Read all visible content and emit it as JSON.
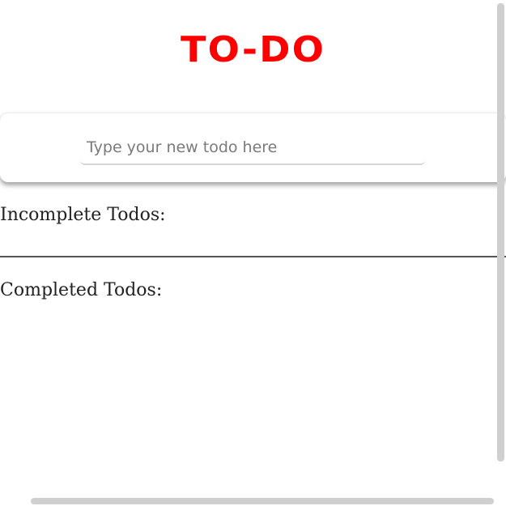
{
  "header": {
    "title": "TO-DO",
    "title_color": "#ff0000"
  },
  "input": {
    "placeholder": "Type your new todo here",
    "value": ""
  },
  "sections": {
    "incomplete": {
      "heading": "Incomplete Todos:",
      "items": []
    },
    "completed": {
      "heading": "Completed Todos:",
      "items": []
    }
  }
}
